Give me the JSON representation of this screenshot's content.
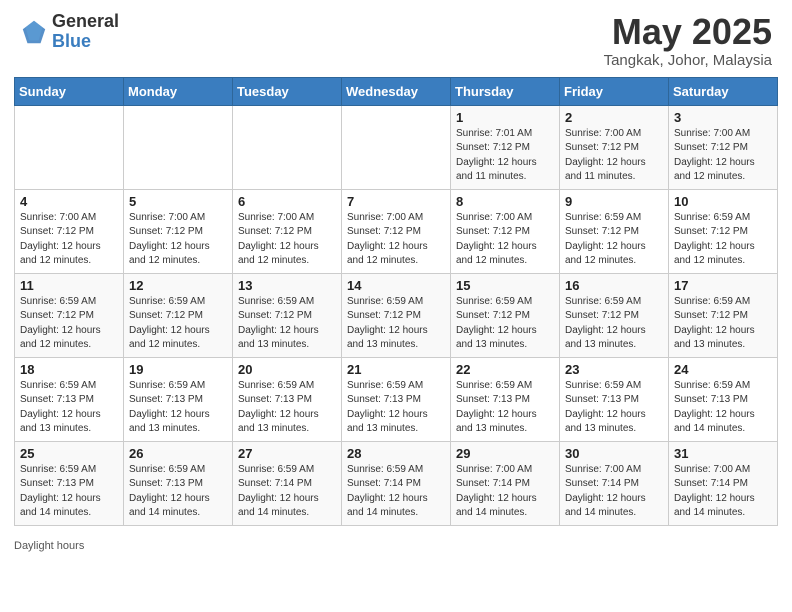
{
  "brand": {
    "general": "General",
    "blue": "Blue"
  },
  "title": "May 2025",
  "subtitle": "Tangkak, Johor, Malaysia",
  "days_of_week": [
    "Sunday",
    "Monday",
    "Tuesday",
    "Wednesday",
    "Thursday",
    "Friday",
    "Saturday"
  ],
  "weeks": [
    [
      {
        "day": "",
        "info": ""
      },
      {
        "day": "",
        "info": ""
      },
      {
        "day": "",
        "info": ""
      },
      {
        "day": "",
        "info": ""
      },
      {
        "day": "1",
        "info": "Sunrise: 7:01 AM\nSunset: 7:12 PM\nDaylight: 12 hours\nand 11 minutes."
      },
      {
        "day": "2",
        "info": "Sunrise: 7:00 AM\nSunset: 7:12 PM\nDaylight: 12 hours\nand 11 minutes."
      },
      {
        "day": "3",
        "info": "Sunrise: 7:00 AM\nSunset: 7:12 PM\nDaylight: 12 hours\nand 12 minutes."
      }
    ],
    [
      {
        "day": "4",
        "info": "Sunrise: 7:00 AM\nSunset: 7:12 PM\nDaylight: 12 hours\nand 12 minutes."
      },
      {
        "day": "5",
        "info": "Sunrise: 7:00 AM\nSunset: 7:12 PM\nDaylight: 12 hours\nand 12 minutes."
      },
      {
        "day": "6",
        "info": "Sunrise: 7:00 AM\nSunset: 7:12 PM\nDaylight: 12 hours\nand 12 minutes."
      },
      {
        "day": "7",
        "info": "Sunrise: 7:00 AM\nSunset: 7:12 PM\nDaylight: 12 hours\nand 12 minutes."
      },
      {
        "day": "8",
        "info": "Sunrise: 7:00 AM\nSunset: 7:12 PM\nDaylight: 12 hours\nand 12 minutes."
      },
      {
        "day": "9",
        "info": "Sunrise: 6:59 AM\nSunset: 7:12 PM\nDaylight: 12 hours\nand 12 minutes."
      },
      {
        "day": "10",
        "info": "Sunrise: 6:59 AM\nSunset: 7:12 PM\nDaylight: 12 hours\nand 12 minutes."
      }
    ],
    [
      {
        "day": "11",
        "info": "Sunrise: 6:59 AM\nSunset: 7:12 PM\nDaylight: 12 hours\nand 12 minutes."
      },
      {
        "day": "12",
        "info": "Sunrise: 6:59 AM\nSunset: 7:12 PM\nDaylight: 12 hours\nand 12 minutes."
      },
      {
        "day": "13",
        "info": "Sunrise: 6:59 AM\nSunset: 7:12 PM\nDaylight: 12 hours\nand 13 minutes."
      },
      {
        "day": "14",
        "info": "Sunrise: 6:59 AM\nSunset: 7:12 PM\nDaylight: 12 hours\nand 13 minutes."
      },
      {
        "day": "15",
        "info": "Sunrise: 6:59 AM\nSunset: 7:12 PM\nDaylight: 12 hours\nand 13 minutes."
      },
      {
        "day": "16",
        "info": "Sunrise: 6:59 AM\nSunset: 7:12 PM\nDaylight: 12 hours\nand 13 minutes."
      },
      {
        "day": "17",
        "info": "Sunrise: 6:59 AM\nSunset: 7:12 PM\nDaylight: 12 hours\nand 13 minutes."
      }
    ],
    [
      {
        "day": "18",
        "info": "Sunrise: 6:59 AM\nSunset: 7:13 PM\nDaylight: 12 hours\nand 13 minutes."
      },
      {
        "day": "19",
        "info": "Sunrise: 6:59 AM\nSunset: 7:13 PM\nDaylight: 12 hours\nand 13 minutes."
      },
      {
        "day": "20",
        "info": "Sunrise: 6:59 AM\nSunset: 7:13 PM\nDaylight: 12 hours\nand 13 minutes."
      },
      {
        "day": "21",
        "info": "Sunrise: 6:59 AM\nSunset: 7:13 PM\nDaylight: 12 hours\nand 13 minutes."
      },
      {
        "day": "22",
        "info": "Sunrise: 6:59 AM\nSunset: 7:13 PM\nDaylight: 12 hours\nand 13 minutes."
      },
      {
        "day": "23",
        "info": "Sunrise: 6:59 AM\nSunset: 7:13 PM\nDaylight: 12 hours\nand 13 minutes."
      },
      {
        "day": "24",
        "info": "Sunrise: 6:59 AM\nSunset: 7:13 PM\nDaylight: 12 hours\nand 14 minutes."
      }
    ],
    [
      {
        "day": "25",
        "info": "Sunrise: 6:59 AM\nSunset: 7:13 PM\nDaylight: 12 hours\nand 14 minutes."
      },
      {
        "day": "26",
        "info": "Sunrise: 6:59 AM\nSunset: 7:13 PM\nDaylight: 12 hours\nand 14 minutes."
      },
      {
        "day": "27",
        "info": "Sunrise: 6:59 AM\nSunset: 7:14 PM\nDaylight: 12 hours\nand 14 minutes."
      },
      {
        "day": "28",
        "info": "Sunrise: 6:59 AM\nSunset: 7:14 PM\nDaylight: 12 hours\nand 14 minutes."
      },
      {
        "day": "29",
        "info": "Sunrise: 7:00 AM\nSunset: 7:14 PM\nDaylight: 12 hours\nand 14 minutes."
      },
      {
        "day": "30",
        "info": "Sunrise: 7:00 AM\nSunset: 7:14 PM\nDaylight: 12 hours\nand 14 minutes."
      },
      {
        "day": "31",
        "info": "Sunrise: 7:00 AM\nSunset: 7:14 PM\nDaylight: 12 hours\nand 14 minutes."
      }
    ]
  ],
  "footer": "Daylight hours"
}
